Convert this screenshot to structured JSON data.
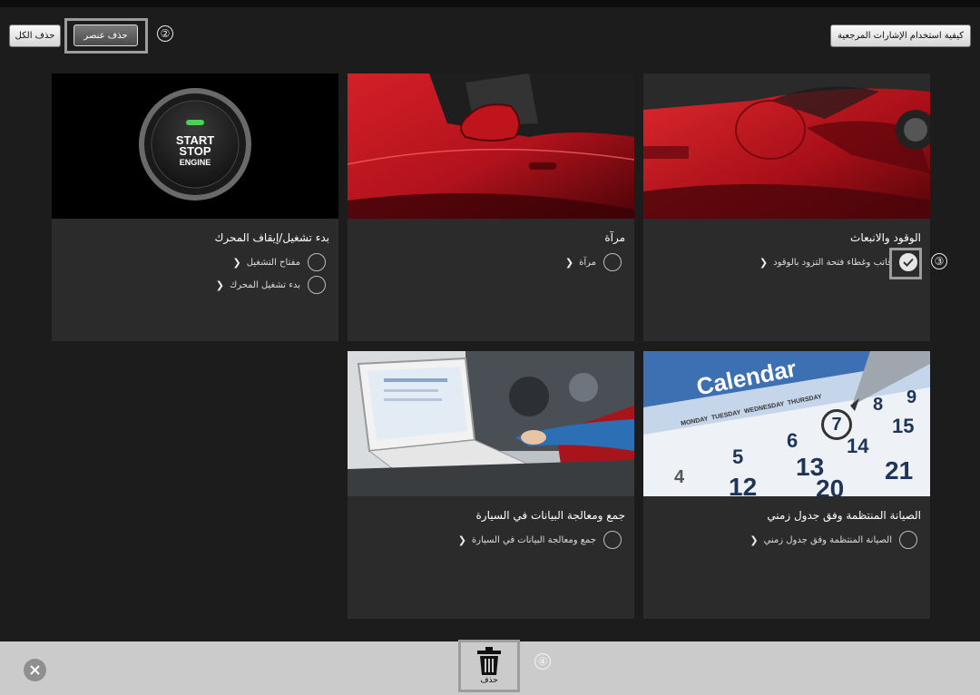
{
  "toolbar": {
    "delete_all": "حذف الكل",
    "delete_item": "حذف عنصر",
    "how_to": "كيفية استخدام الإشارات المرجعية"
  },
  "callouts": [
    "②",
    "③",
    "④"
  ],
  "cards": [
    {
      "title": "الوقود والانبعاث",
      "items": [
        {
          "label": "قاتب وغطاء فتحة التزود بالوقود",
          "checked": true
        }
      ]
    },
    {
      "title": "مرآة",
      "items": [
        {
          "label": "مرآة",
          "checked": false
        }
      ]
    },
    {
      "title": "بدء تشغيل/إيقاف المحرك",
      "image_text": [
        "START",
        "STOP",
        "ENGINE"
      ],
      "items": [
        {
          "label": "مفتاح التشغيل",
          "checked": false
        },
        {
          "label": "بدء تشغيل المحرك",
          "checked": false
        }
      ]
    },
    {
      "title": "الصيانة المنتظمة وفق جدول زمني",
      "image_text": {
        "heading": "Calendar",
        "days": [
          "MONDAY",
          "TUESDAY",
          "WEDNESDAY",
          "THURSDAY"
        ],
        "numbers": [
          "7",
          "8",
          "9",
          "5",
          "6",
          "14",
          "15",
          "4",
          "12",
          "13",
          "20",
          "21"
        ]
      },
      "items": [
        {
          "label": "الصيانة المنتظمة وفق جدول زمني",
          "checked": false
        }
      ]
    },
    {
      "title": "جمع ومعالجة البيانات في السيارة",
      "items": [
        {
          "label": "جمع ومعالجة البيانات في السيارة",
          "checked": false
        }
      ]
    }
  ],
  "bottom": {
    "delete_label": "حذف"
  },
  "colors": {
    "background": "#1c1c1c",
    "card": "#2b2b2b",
    "bar": "#cbcbcb",
    "highlight": "#9d9d9d",
    "car_red": "#b3121d"
  }
}
